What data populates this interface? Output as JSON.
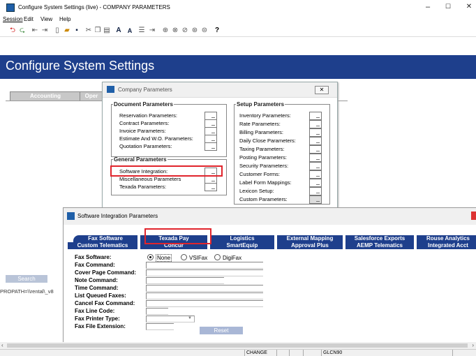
{
  "window": {
    "title": "Configure System Settings (live) - COMPANY PARAMETERS",
    "minimize": "–",
    "maximize": "☐",
    "close": "✕"
  },
  "menu": [
    "Session",
    "Edit",
    "View",
    "Help"
  ],
  "header": {
    "title": "Configure System Settings"
  },
  "background_tabs": [
    "Accounting",
    "Oper"
  ],
  "left_panel": {
    "search_label": "Search",
    "path_text": "PROPATH=\\\\rental\\_v8"
  },
  "company_dialog": {
    "title": "Company Parameters",
    "close": "✕",
    "document_group": {
      "label": "Document Parameters",
      "items": [
        "Reservation Parameters:",
        "Contract Parameters:",
        "Invoice Parameters:",
        "Estimate And W.O. Parameters:",
        "Quotation Parameters:"
      ]
    },
    "general_group": {
      "label": "General Parameters",
      "items": [
        "Software Integration:",
        "Miscellaneous Parameters",
        "Texada Parameters:"
      ]
    },
    "setup_group": {
      "label": "Setup Parameters",
      "items": [
        "Inventory Parameters:",
        "Rate Parameters:",
        "Billing Parameters:",
        "Daily Close Parameters:",
        "Taxing Parameters:",
        "Posting Parameters:",
        "Security Parameters:",
        "Customer Forms:",
        "Label Form Mappings:",
        "Lexicon Setup:",
        "Custom Parameters:"
      ]
    }
  },
  "integration_window": {
    "title": "Software Integration Parameters",
    "tabs_row1": [
      "Fax Software",
      "Texada Pay",
      "Logistics",
      "External Mapping",
      "Salesforce Exports",
      "Rouse Analytics"
    ],
    "tabs_row2": [
      "Custom Telematics",
      "Concur",
      "SmartEquip",
      "Approval Plus",
      "AEMP Telematics",
      "Integrated Acct"
    ],
    "fax_software": {
      "label": "Fax Software:",
      "options": [
        "None",
        "VSIFax",
        "DigiFax"
      ],
      "selected": "None"
    },
    "fields": [
      "Fax Command:",
      "Cover Page Command:",
      "Note Command:",
      "Time Command:",
      "List Queued Faxes:",
      "Cancel Fax Command:",
      "Fax Line Code:",
      "Fax Printer Type:",
      "Fax File Extension:"
    ],
    "reset_label": "Reset"
  },
  "statusbar": {
    "mode": "CHANGE",
    "code": "GLCN90"
  }
}
